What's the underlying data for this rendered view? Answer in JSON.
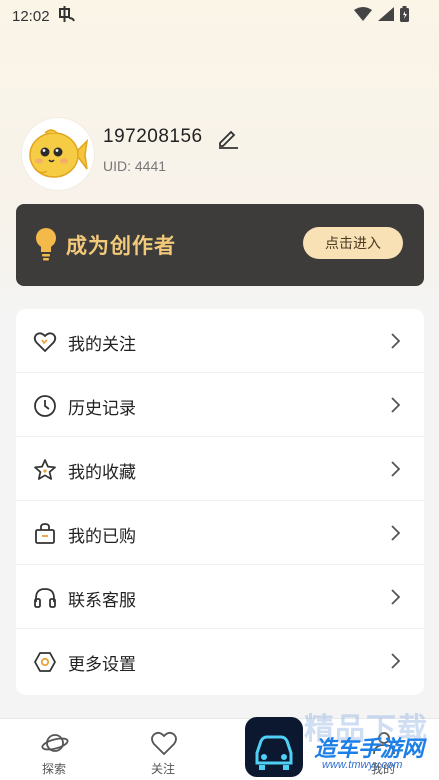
{
  "status_bar": {
    "time": "12:02",
    "notif_icon": "notification-icon",
    "battery_icon": "battery-icon"
  },
  "profile": {
    "username": "197208156",
    "uid": "UID: 4441"
  },
  "creator_banner": {
    "title": "成为创作者",
    "button": "点击进入",
    "accent": "#f3c97a",
    "bg": "#3d3c3a"
  },
  "menu": {
    "items": [
      {
        "label": "我的关注",
        "icon": "heart-icon"
      },
      {
        "label": "历史记录",
        "icon": "clock-icon"
      },
      {
        "label": "我的收藏",
        "icon": "star-icon"
      },
      {
        "label": "我的已购",
        "icon": "shopping-bag-icon"
      },
      {
        "label": "联系客服",
        "icon": "headset-icon"
      },
      {
        "label": "更多设置",
        "icon": "settings-icon"
      }
    ]
  },
  "tab_bar": {
    "tabs": [
      {
        "label": "探索",
        "icon": "planet-icon"
      },
      {
        "label": "关注",
        "icon": "heart-icon"
      },
      {
        "label": "我的",
        "icon": "user-icon"
      }
    ]
  },
  "watermark": {
    "title": "精品下载",
    "subtitle": "造车手游网",
    "url": "www.tmwyy.com"
  }
}
